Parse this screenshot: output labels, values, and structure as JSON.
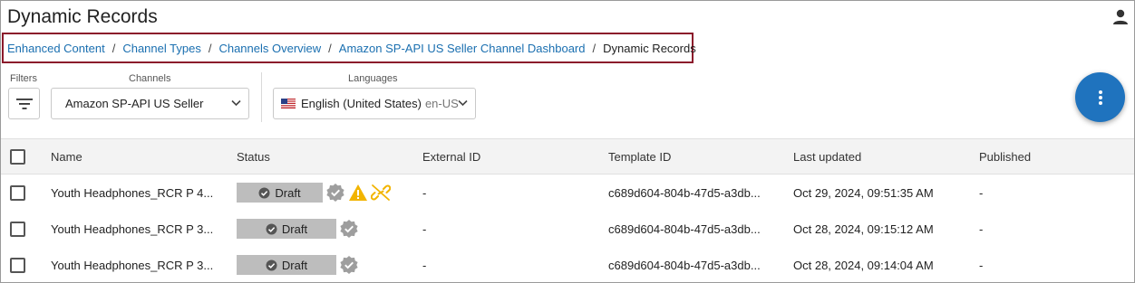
{
  "page": {
    "title": "Dynamic Records"
  },
  "breadcrumb": {
    "items": [
      "Enhanced Content",
      "Channel Types",
      "Channels Overview",
      "Amazon SP-API US Seller Channel Dashboard"
    ],
    "separator": "/",
    "current": "Dynamic Records"
  },
  "toolbar": {
    "filters_label": "Filters",
    "channels_label": "Channels",
    "channel_value": "Amazon SP-API US Seller",
    "languages_label": "Languages",
    "language_value": "English (United States)",
    "language_code": "en-US"
  },
  "table": {
    "columns": [
      "Name",
      "Status",
      "External ID",
      "Template ID",
      "Last updated",
      "Published"
    ],
    "rows": [
      {
        "name": "Youth Headphones_RCR P 4...",
        "status": "Draft",
        "external_id": "-",
        "template_id": "c689d604-804b-47d5-a3db...",
        "last_updated": "Oct 29, 2024, 09:51:35 AM",
        "published": "-",
        "icons": [
          "verified-badge-icon",
          "warning-icon",
          "unlinked-icon"
        ]
      },
      {
        "name": "Youth Headphones_RCR P 3...",
        "status": "Draft",
        "external_id": "-",
        "template_id": "c689d604-804b-47d5-a3db...",
        "last_updated": "Oct 28, 2024, 09:15:12 AM",
        "published": "-",
        "icons": [
          "verified-badge-icon"
        ]
      },
      {
        "name": "Youth Headphones_RCR P 3...",
        "status": "Draft",
        "external_id": "-",
        "template_id": "c689d604-804b-47d5-a3db...",
        "last_updated": "Oct 28, 2024, 09:14:04 AM",
        "published": "-",
        "icons": [
          "verified-badge-icon"
        ]
      }
    ]
  },
  "colors": {
    "accent": "#1f73be",
    "link": "#1a6fb0",
    "highlight_border": "#8b1a2b",
    "warning": "#f2b400",
    "badge": "#bdbdbd"
  }
}
